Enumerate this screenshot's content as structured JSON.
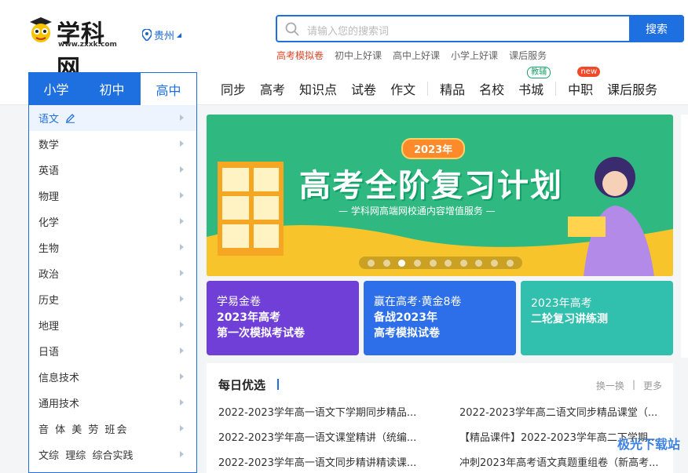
{
  "header": {
    "logo_text": "学科网",
    "logo_sub": "www.zxxk.com",
    "location": "贵州"
  },
  "search": {
    "placeholder": "请输入您的搜索词",
    "button": "搜索"
  },
  "hot_links": [
    "高考模拟卷",
    "初中上好课",
    "高中上好课",
    "小学上好课",
    "课后服务"
  ],
  "grades": [
    {
      "label": "小学",
      "active": false
    },
    {
      "label": "初中",
      "active": false
    },
    {
      "label": "高中",
      "active": true
    }
  ],
  "nav": [
    "同步",
    "高考",
    "知识点",
    "试卷",
    "作文",
    "精品",
    "名校",
    "书城",
    "中职",
    "课后服务"
  ],
  "nav_tags": {
    "shucheng": "教辅",
    "zhongzhi": "new"
  },
  "subjects": [
    "语文",
    "数学",
    "英语",
    "物理",
    "化学",
    "生物",
    "政治",
    "历史",
    "地理",
    "日语",
    "信息技术",
    "通用技术",
    "音 体 美 劳 班会",
    "文综  理综  综合实践"
  ],
  "banner": {
    "year": "2023年",
    "title": "高考全阶复习计划",
    "subtitle": "— 学科网高端网校通内容增值服务 —",
    "dots": 10,
    "active_dot": 3
  },
  "cards": [
    {
      "l1": "学易金卷",
      "l2": "2023年高考",
      "l3": "第一次模拟考试卷"
    },
    {
      "l1": "赢在高考·黄金8卷",
      "l2": "备战2023年",
      "l3": "高考模拟试卷"
    },
    {
      "l1": "2023年高考",
      "l2": "二轮复习讲练测",
      "l3": ""
    }
  ],
  "daily": {
    "title": "每日优选",
    "refresh": "换一换",
    "more": "更多",
    "items": [
      "2022-2023学年高一语文下学期同步精品...",
      "2022-2023学年高二语文同步精品课堂（...",
      "2022-2023学年高一语文课堂精讲（统编...",
      "【精品课件】2022-2023学年高二下学期...",
      "2022-2023学年高一语文同步精讲精读课...",
      "冲刺2023年高考语文真题重组卷（新高考..."
    ]
  },
  "watermark": "极光下载站"
}
